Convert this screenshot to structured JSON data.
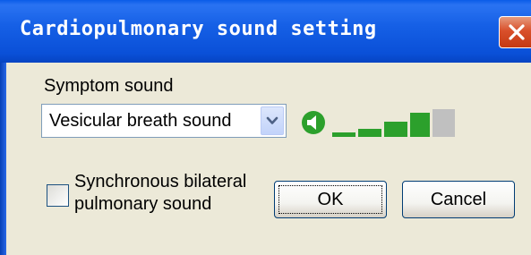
{
  "window": {
    "title": "Cardiopulmonary sound setting",
    "close_icon": "close-icon"
  },
  "symptom": {
    "label": "Symptom sound",
    "selected": "Vesicular breath sound",
    "dropdown_icon": "chevron-down-icon"
  },
  "volume": {
    "icon": "speaker-icon",
    "level": 4,
    "max_level": 5,
    "active_color": "#2ca02c",
    "inactive_color": "#c0c0c0"
  },
  "sync": {
    "label": "Synchronous bilateral pulmonary sound",
    "checked": false
  },
  "buttons": {
    "ok": "OK",
    "cancel": "Cancel"
  },
  "colors": {
    "titlebar": "#0a5ce8",
    "dialog_bg": "#ece9d8",
    "close_button": "#d9502b"
  }
}
